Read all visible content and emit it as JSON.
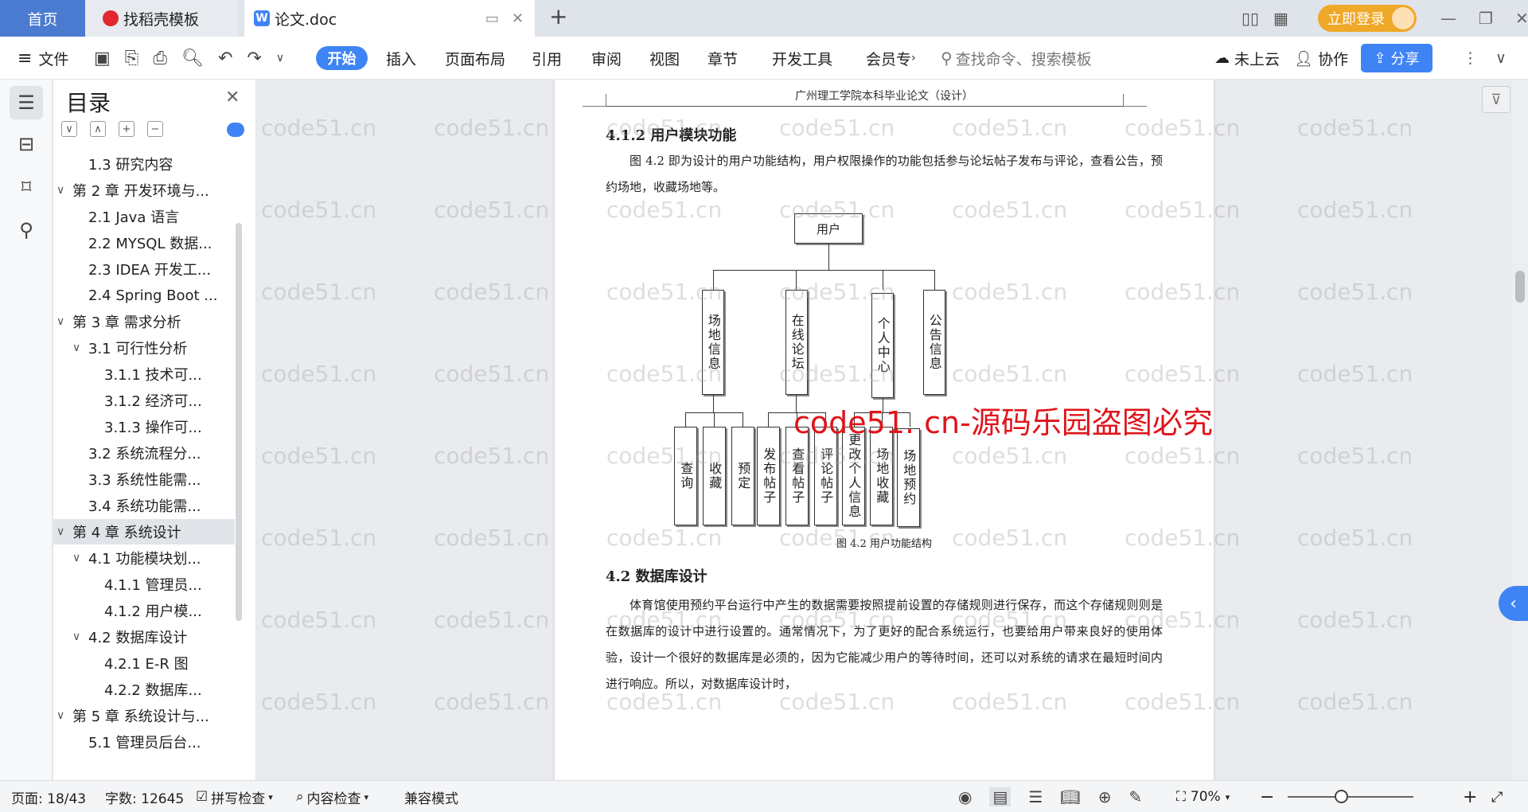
{
  "tabs": {
    "home": "首页",
    "daoke": "找稻壳模板",
    "doc": "论文.doc"
  },
  "window": {
    "login": "立即登录"
  },
  "toolbar": {
    "file": "文件",
    "items": [
      "开始",
      "插入",
      "页面布局",
      "引用",
      "审阅",
      "视图",
      "章节",
      "开发工具",
      "会员专"
    ],
    "search_placeholder": "查找命令、搜索模板",
    "cloud": "未上云",
    "collab": "协作",
    "share": "分享"
  },
  "outline": {
    "title": "目录",
    "items": [
      {
        "label": "1.3 研究内容",
        "level": 2
      },
      {
        "label": "第 2 章 开发环境与...",
        "level": 1
      },
      {
        "label": "2.1 Java 语言",
        "level": 2
      },
      {
        "label": "2.2 MYSQL 数据...",
        "level": 2
      },
      {
        "label": "2.3 IDEA 开发工...",
        "level": 2
      },
      {
        "label": "2.4 Spring Boot ...",
        "level": 2
      },
      {
        "label": "第 3 章 需求分析",
        "level": 1
      },
      {
        "label": "3.1 可行性分析",
        "level": 2
      },
      {
        "label": "3.1.1 技术可...",
        "level": 3
      },
      {
        "label": "3.1.2 经济可...",
        "level": 3
      },
      {
        "label": "3.1.3 操作可...",
        "level": 3
      },
      {
        "label": "3.2 系统流程分...",
        "level": 2
      },
      {
        "label": "3.3 系统性能需...",
        "level": 2
      },
      {
        "label": "3.4 系统功能需...",
        "level": 2
      },
      {
        "label": "第 4 章 系统设计",
        "level": 1
      },
      {
        "label": "4.1 功能模块划...",
        "level": 2
      },
      {
        "label": "4.1.1 管理员...",
        "level": 3
      },
      {
        "label": "4.1.2 用户模...",
        "level": 3
      },
      {
        "label": "4.2 数据库设计",
        "level": 2
      },
      {
        "label": "4.2.1 E-R 图",
        "level": 3
      },
      {
        "label": "4.2.2 数据库...",
        "level": 3
      },
      {
        "label": "第 5 章 系统设计与...",
        "level": 1
      },
      {
        "label": "5.1 管理员后台...",
        "level": 2
      }
    ],
    "selected": "第 4 章 系统设计"
  },
  "document": {
    "header": "广州理工学院本科毕业论文（设计）",
    "heading1": "4.1.2  用户模块功能",
    "para1": "图 4.2 即为设计的用户功能结构，用户权限操作的功能包括参与论坛帖子发布与评论，查看公告，预约场地，收藏场地等。",
    "diagram": {
      "root": "用户",
      "level1": [
        "场地信息",
        "在线论坛",
        "个人中心",
        "公告信息"
      ],
      "level2": [
        "查询",
        "收藏",
        "预定",
        "发布帖子",
        "查看帖子",
        "评论帖子",
        "更改个人信息",
        "场地收藏",
        "场地预约"
      ]
    },
    "caption": "图 4.2  用户功能结构",
    "heading2": "4.2  数据库设计",
    "para2": "体育馆使用预约平台运行中产生的数据需要按照提前设置的存储规则进行保存，而这个存储规则则是在数据库的设计中进行设置的。通常情况下，为了更好的配合系统运行，也要给用户带来良好的使用体验，设计一个很好的数据库是必须的，因为它能减少用户的等待时间，还可以对系统的请求在最短时间内进行响应。所以，对数据库设计时，",
    "watermark": "code51.cn",
    "stamp": "code51. cn-源码乐园盗图必究"
  },
  "status": {
    "page": "页面: 18/43",
    "words": "字数: 12645",
    "spell": "拼写检查",
    "content": "内容检查",
    "compat": "兼容模式",
    "zoom": "70%"
  }
}
